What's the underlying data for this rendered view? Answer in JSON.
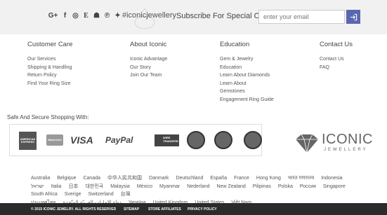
{
  "topbar": {
    "social_icons": [
      {
        "name": "google-plus-icon",
        "glyph": "G+"
      },
      {
        "name": "facebook-icon",
        "glyph": "f"
      },
      {
        "name": "instagram-icon",
        "glyph": "◎"
      },
      {
        "name": "etsy-icon",
        "glyph": "E"
      },
      {
        "name": "snapchat-icon",
        "glyph": "☗"
      },
      {
        "name": "pinterest-icon",
        "glyph": "℗"
      },
      {
        "name": "twitter-icon",
        "glyph": "✦"
      }
    ],
    "hashtag": "#iconicjewellery",
    "subscribe_text": "Subscribe For Special Offers!",
    "email_placeholder": "enter your email"
  },
  "columns": [
    {
      "title": "Customer Care",
      "links": [
        "Our Services",
        "Shipping & Handling",
        "Return Policy",
        "Find Your Ring Size"
      ]
    },
    {
      "title": "About Iconic",
      "links": [
        "Iconic Advantage",
        "Our Story",
        "Join Our Team"
      ]
    },
    {
      "title": "Education",
      "links": [
        "Gem & Jewelry",
        "Education",
        "Learn About Diamonds",
        "Learn About",
        "Gemstones",
        "Engagement Ring Guide"
      ]
    },
    {
      "title": "Contact Us",
      "links": [
        "Contact Us",
        "FAQ"
      ]
    }
  ],
  "payments": {
    "heading": "Safe And Secure Shopping With:",
    "amex": "AMERICAN EXPRESS",
    "mastercard": "MasterCard",
    "visa": "VISA",
    "paypal": "PayPal",
    "wire": "WIRE TRANSFER"
  },
  "logo": {
    "name": "ICONIC",
    "sub": "JEWELLERY"
  },
  "countries": [
    "Australia",
    "Belgique",
    "Canada",
    "中华人民共和国",
    "Danmark",
    "Deutschland",
    "España",
    "France",
    "Hong Kong",
    "भारत गणराज्य",
    "Indonesia",
    "ישראל",
    "Italia",
    "日本",
    "대한민국",
    "Malaysia",
    "México",
    "Myanmar",
    "Nederland",
    "New Zealand",
    "Pilipinas",
    "Polska",
    "Россия",
    "Singapore",
    "South Africa",
    "Sverige",
    "Switzerland",
    "台灣",
    "ประเทศไทย",
    "دولة الإمارات العربيّة المتّحدة",
    "Україна",
    "United Kingdom",
    "United States",
    "Việt Nam"
  ],
  "bottombar": {
    "copyright": "© 2015 ICONIC JEWELRY. ALL RIGHTS RESERVED",
    "links": [
      "SITEMAP",
      "STORE AFFILIATES",
      "PRIVACY POLICY"
    ]
  },
  "colors": {
    "accent": "#5a67b0",
    "footer_bg": "#2b2b2b",
    "topbar_bg": "#f1f1f1"
  }
}
